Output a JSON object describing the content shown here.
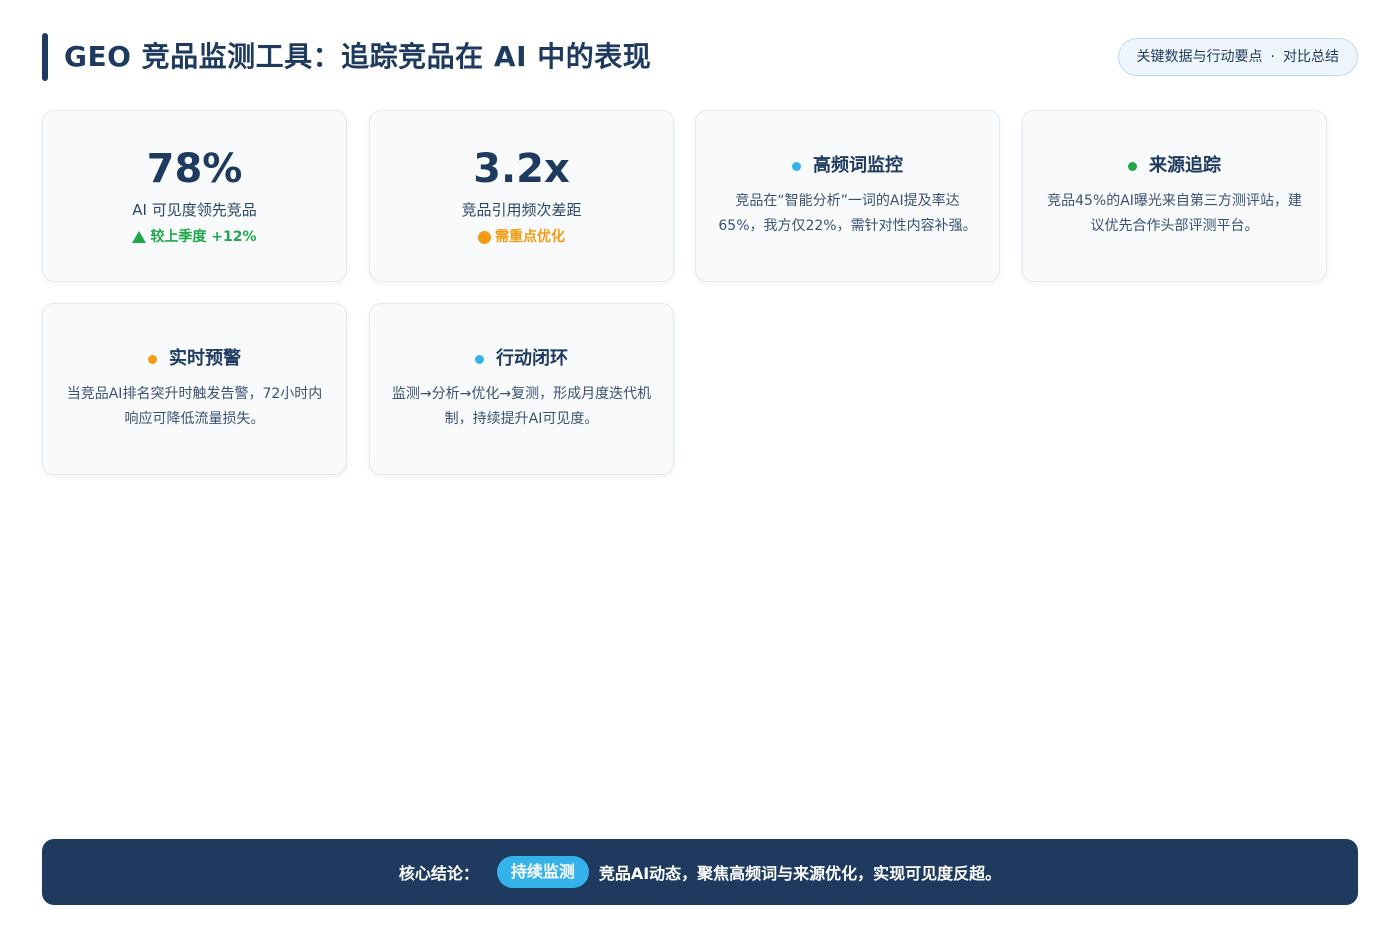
{
  "header": {
    "title": "GEO 竞品监测工具：追踪竞品在 AI 中的表现",
    "pill_left": "关键数据与行动要点",
    "pill_sep": "·",
    "pill_right": "对比总结"
  },
  "stats": [
    {
      "value": "78%",
      "label": "AI 可见度领先竞品",
      "trend": "较上季度 +12%",
      "trend_color": "#22a84a"
    },
    {
      "value": "3.2x",
      "label": "竞品引用频次差距",
      "trend": "需重点优化",
      "trend_color": "#f39c12"
    }
  ],
  "features": [
    {
      "title": "高频词监控",
      "dot_color": "#35b2ea",
      "desc": "竞品在“智能分析”一词的AI提及率达65%，我方仅22%，需针对性内容补强。"
    },
    {
      "title": "来源追踪",
      "dot_color": "#22a84a",
      "desc": "竞品45%的AI曝光来自第三方测评站，建议优先合作头部评测平台。"
    },
    {
      "title": "实时预警",
      "dot_color": "#f39c12",
      "desc": "当竞品AI排名突升时触发告警，72小时内响应可降低流量损失。"
    },
    {
      "title": "行动闭环",
      "dot_color": "#35b2ea",
      "desc": "监测→分析→优化→复测，形成月度迭代机制，持续提升AI可见度。"
    }
  ],
  "footer": {
    "label": "核心结论：",
    "tag": "持续监测",
    "text": "竞品AI动态，聚焦高频词与来源优化，实现可见度反超。"
  },
  "colors": {
    "primary": "#1e3a5f",
    "accent": "#35b2ea",
    "green": "#22a84a",
    "orange": "#f39c12"
  }
}
